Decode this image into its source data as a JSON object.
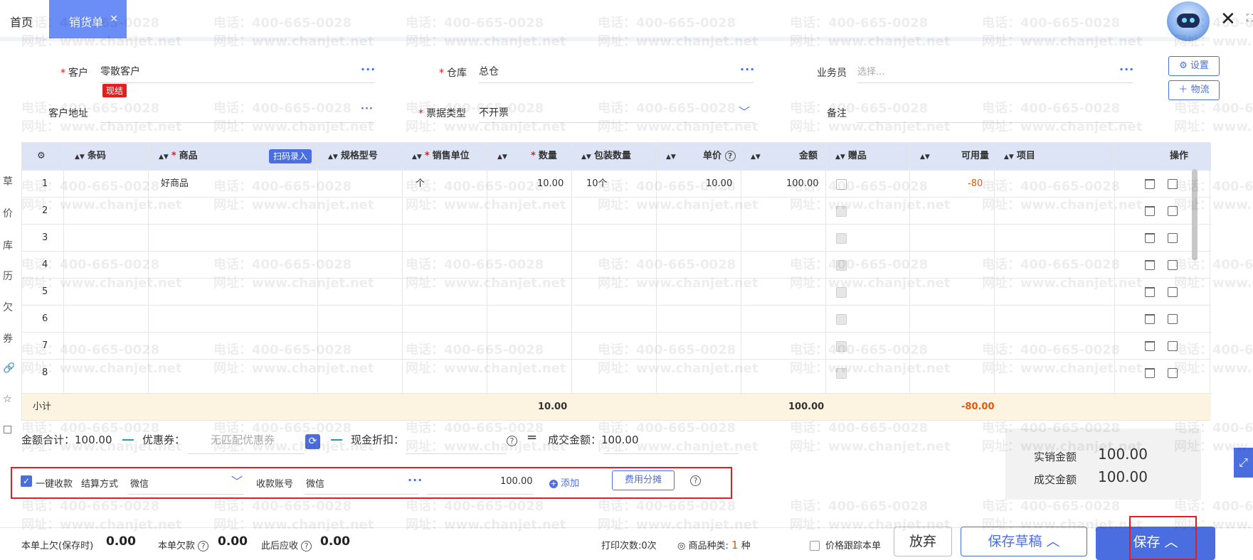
{
  "tabs": {
    "home": "首页",
    "active": "销货单"
  },
  "watermark": {
    "phone": "电话：400-665-0028",
    "site": "网址：www.chanjet.net"
  },
  "form": {
    "customer_label": "客户",
    "customer_value": "零散客户",
    "customer_tag": "现结",
    "warehouse_label": "仓库",
    "warehouse_value": "总仓",
    "salesperson_label": "业务员",
    "salesperson_placeholder": "选择...",
    "address_label": "客户地址",
    "invoice_label": "票据类型",
    "invoice_value": "不开票",
    "note_label": "备注",
    "settings_btn": "设置",
    "logistics_btn": "物流"
  },
  "table": {
    "headers": {
      "barcode": "条码",
      "product": "商品",
      "scan_badge": "扫码录入",
      "spec": "规格型号",
      "unit": "销售单位",
      "qty": "数量",
      "pack_qty": "包装数量",
      "price": "单价",
      "amount": "金额",
      "gift": "赠品",
      "available": "可用量",
      "project": "项目",
      "ops": "操作"
    },
    "rows": [
      {
        "no": "1",
        "product": "好商品",
        "unit": "个",
        "qty": "10.00",
        "pack_qty": "10个",
        "price": "10.00",
        "amount": "100.00",
        "available": "-80"
      },
      {
        "no": "2"
      },
      {
        "no": "3"
      },
      {
        "no": "4"
      },
      {
        "no": "5"
      },
      {
        "no": "6"
      },
      {
        "no": "7"
      },
      {
        "no": "8"
      }
    ],
    "subtotal": {
      "label": "小计",
      "qty": "10.00",
      "amount": "100.00",
      "available": "-80.00"
    }
  },
  "totals": {
    "sum_label": "金额合计：",
    "sum_value": "100.00",
    "coupon_label": "优惠券：",
    "coupon_placeholder": "无匹配优惠券",
    "discount_label": "现金折扣：",
    "deal_label": "成交金额：",
    "deal_value": "100.00"
  },
  "payment": {
    "quick_label": "一键收款",
    "method_label": "结算方式",
    "method_value": "微信",
    "account_label": "收款账号",
    "account_value": "微信",
    "amount": "100.00",
    "add_label": "添加",
    "alloc_label": "费用分摊"
  },
  "summary": {
    "actual_label": "实销金额",
    "actual_value": "100.00",
    "deal_label": "成交金额",
    "deal_value": "100.00"
  },
  "bottom": {
    "prev_debt_label": "本单上欠(保存时)",
    "prev_debt_value": "0.00",
    "debt_label": "本单欠款",
    "debt_value": "0.00",
    "after_label": "此后应收",
    "after_value": "0.00",
    "print_count": "打印次数:0次",
    "kinds_label": "商品种类:",
    "kinds_value": "1",
    "kinds_unit": "种",
    "price_track": "价格跟踪本单",
    "discard": "放弃",
    "draft": "保存草稿",
    "save": "保存"
  },
  "side_tools": [
    "草",
    "价",
    "库",
    "历",
    "欠",
    "券",
    "🔗",
    "☆",
    "□"
  ],
  "colors": {
    "accent": "#4a6ee0",
    "required": "#e02020",
    "negative": "#e05a10"
  }
}
